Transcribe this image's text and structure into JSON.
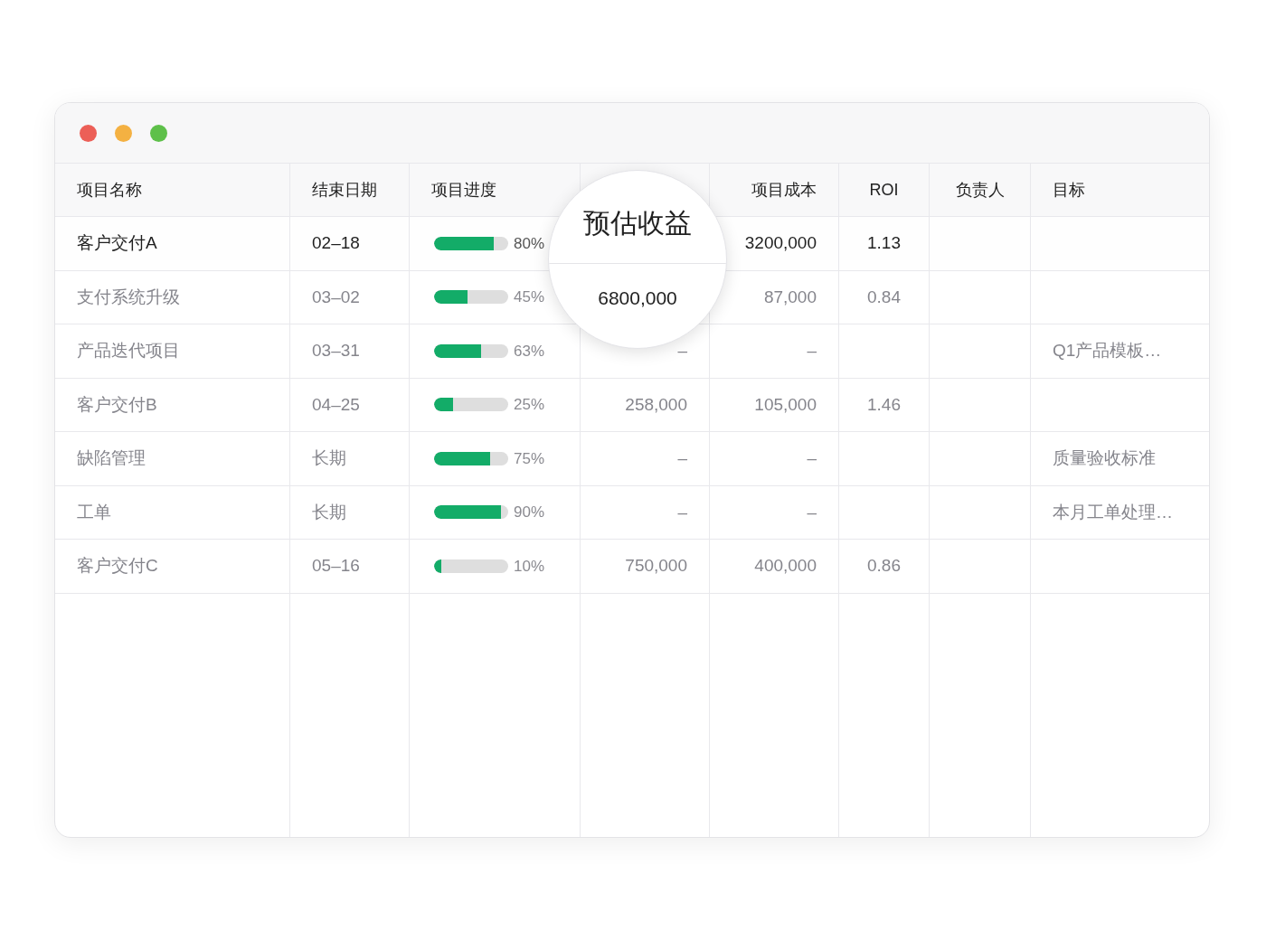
{
  "window": {
    "controls": [
      {
        "kind": "close"
      },
      {
        "kind": "minimize"
      },
      {
        "kind": "zoom"
      }
    ]
  },
  "table": {
    "columns": [
      {
        "label": "项目名称"
      },
      {
        "label": "结束日期"
      },
      {
        "label": "项目进度"
      },
      {},
      {
        "label": "项目成本"
      },
      {
        "label": "ROI"
      },
      {
        "label": "负责人"
      },
      {
        "label": "目标"
      }
    ],
    "rows": [
      {
        "selected": true,
        "name": "客户交付A",
        "date": "02–18",
        "progress": {
          "level": 0.8,
          "text": "80%"
        },
        "cost": "3200,000",
        "roi": "1.13"
      },
      {
        "selected": false,
        "name": "支付系统升级",
        "date": "03–02",
        "progress": {
          "level": 0.45,
          "text": "45%"
        },
        "cost": "87,000",
        "roi": "0.84"
      },
      {
        "selected": false,
        "name": "产品迭代项目",
        "date": "03–31",
        "progress": {
          "level": 0.63,
          "text": "63%"
        },
        "revenue": "–",
        "cost": "–",
        "goal": "Q1产品模板…"
      },
      {
        "selected": false,
        "name": "客户交付B",
        "date": "04–25",
        "progress": {
          "level": 0.25,
          "text": "25%"
        },
        "revenue": "258,000",
        "cost": "105,000",
        "roi": "1.46"
      },
      {
        "selected": false,
        "name": "缺陷管理",
        "date": "长期",
        "progress": {
          "level": 0.75,
          "text": "75%"
        },
        "revenue": "–",
        "cost": "–",
        "goal": "质量验收标准"
      },
      {
        "selected": false,
        "name": "工单",
        "date": "长期",
        "progress": {
          "level": 0.9,
          "text": "90%"
        },
        "revenue": "–",
        "cost": "–",
        "goal": "本月工单处理…"
      },
      {
        "selected": false,
        "name": "客户交付C",
        "date": "05–16",
        "progress": {
          "level": 0.1,
          "text": "10%"
        },
        "revenue": "750,000",
        "cost": "400,000",
        "roi": "0.86"
      }
    ]
  },
  "magnifier": {
    "column_label": "预估收益",
    "value": "6800,000"
  }
}
